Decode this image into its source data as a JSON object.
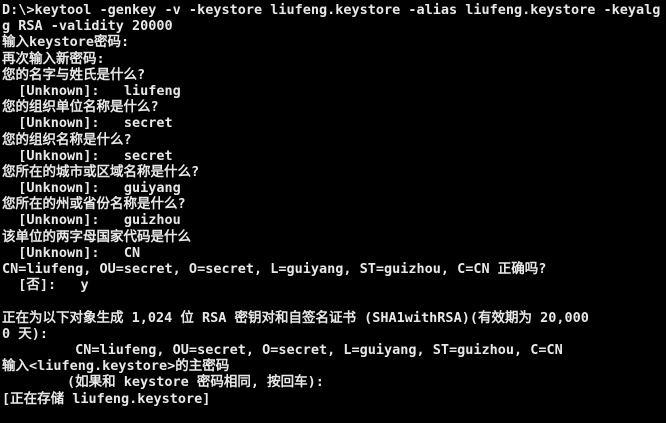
{
  "console": {
    "lines": [
      "D:\\>keytool -genkey -v -keystore liufeng.keystore -alias liufeng.keystore -keyalg",
      "g RSA -validity 20000",
      "输入keystore密码:",
      "再次输入新密码:",
      "您的名字与姓氏是什么?",
      "  [Unknown]:   liufeng",
      "您的组织单位名称是什么?",
      "  [Unknown]:   secret",
      "您的组织名称是什么?",
      "  [Unknown]:   secret",
      "您所在的城市或区域名称是什么?",
      "  [Unknown]:   guiyang",
      "您所在的州或省份名称是什么?",
      "  [Unknown]:   guizhou",
      "该单位的两字母国家代码是什么",
      "  [Unknown]:   CN",
      "CN=liufeng, OU=secret, O=secret, L=guiyang, ST=guizhou, C=CN 正确吗?",
      "  [否]:   y",
      "",
      "正在为以下对象生成 1,024 位 RSA 密钥对和自签名证书 (SHA1withRSA)(有效期为 20,000",
      "0 天):",
      "         CN=liufeng, OU=secret, O=secret, L=guiyang, ST=guizhou, C=CN",
      "输入<liufeng.keystore>的主密码",
      "        (如果和 keystore 密码相同, 按回车):",
      "[正在存储 liufeng.keystore]"
    ]
  }
}
